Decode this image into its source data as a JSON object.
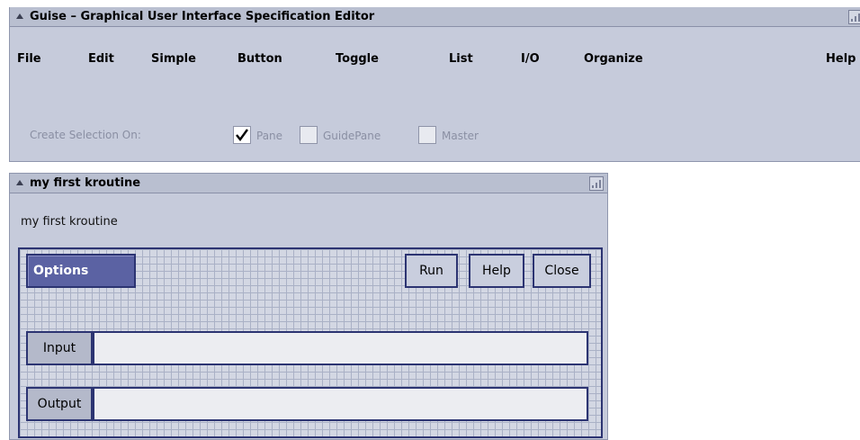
{
  "main_window": {
    "title": "Guise – Graphical User Interface Specification Editor",
    "menu": [
      "File",
      "Edit",
      "Simple",
      "Button",
      "Toggle",
      "List",
      "I/O",
      "Organize",
      "Help"
    ],
    "selection": {
      "label": "Create Selection On:",
      "options": [
        {
          "label": "Pane",
          "checked": true
        },
        {
          "label": "GuidePane",
          "checked": false
        },
        {
          "label": "Master",
          "checked": false
        }
      ]
    }
  },
  "kroutine_window": {
    "title": "my first kroutine",
    "subtitle": "my first kroutine",
    "buttons": {
      "options": "Options",
      "run": "Run",
      "help": "Help",
      "close": "Close"
    },
    "input": {
      "label": "Input",
      "value": ""
    },
    "output": {
      "label": "Output",
      "value": ""
    }
  }
}
